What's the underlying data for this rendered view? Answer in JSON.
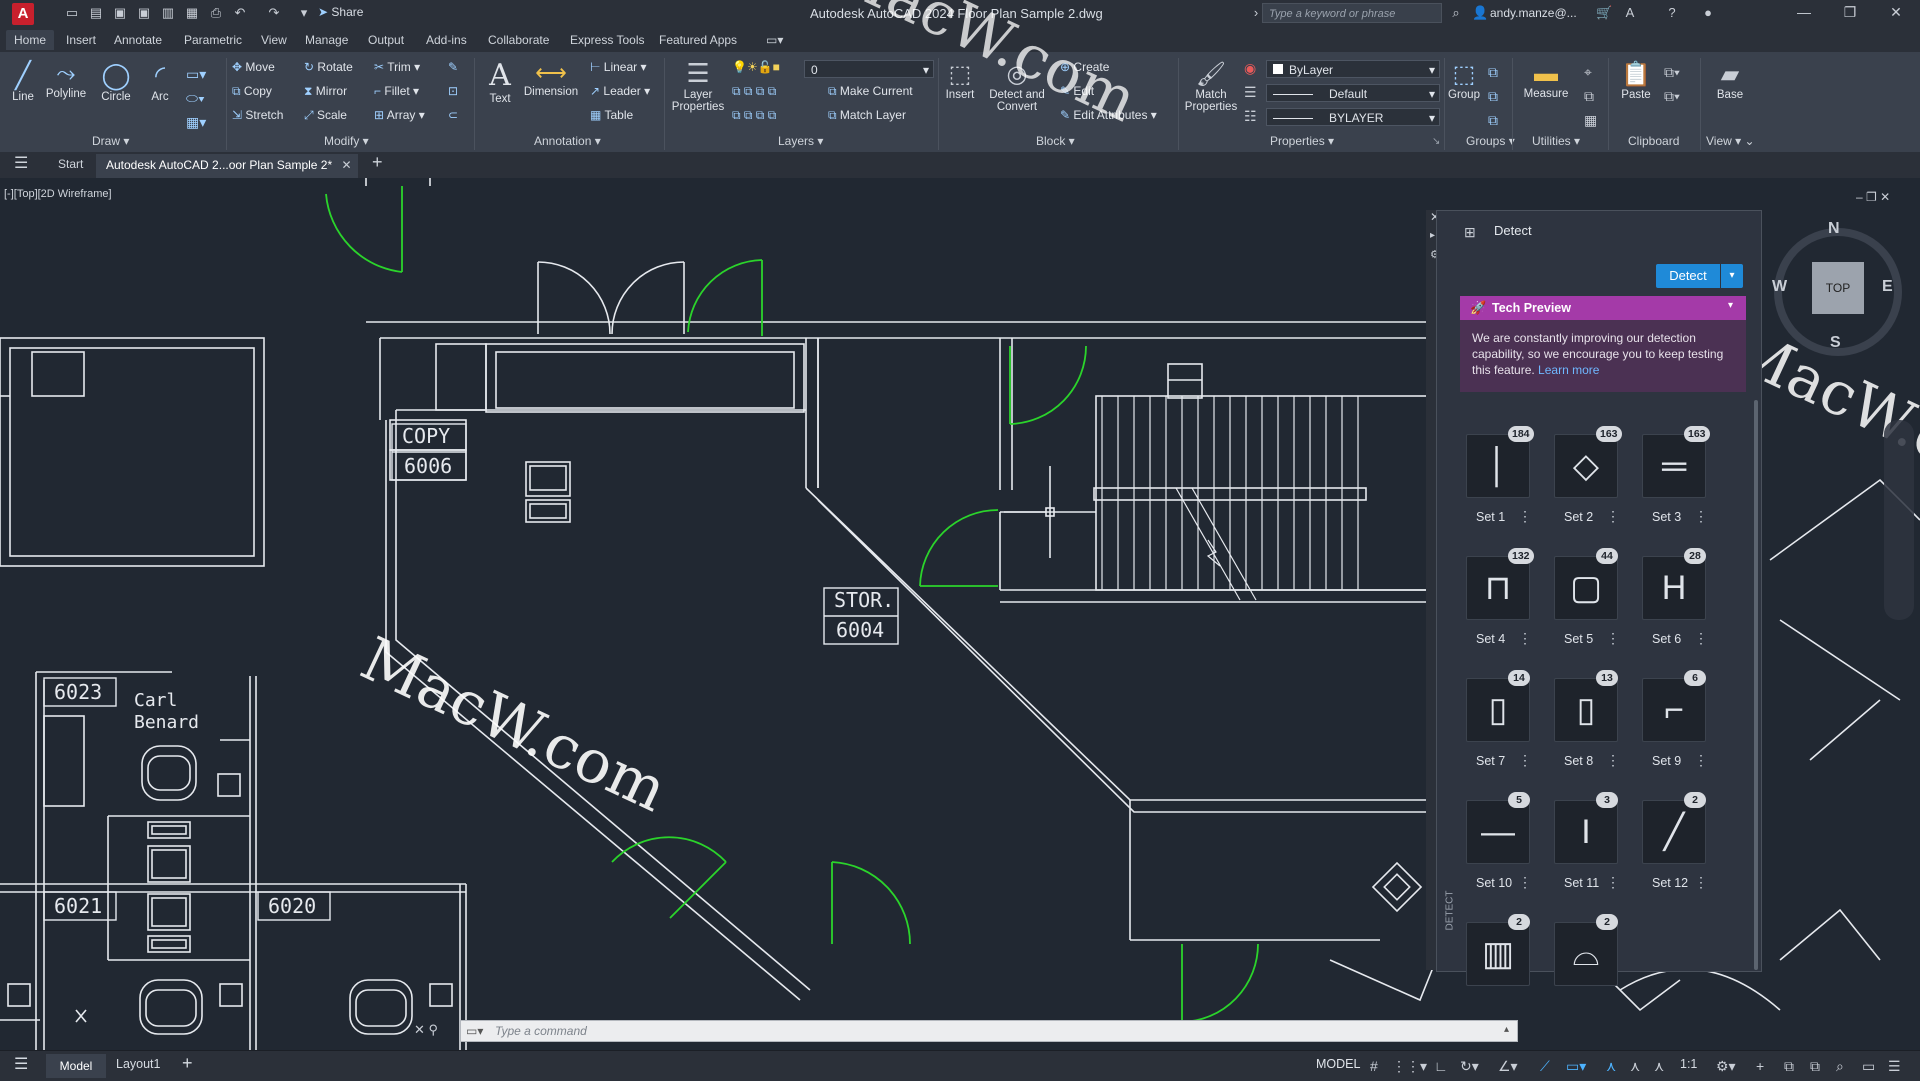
{
  "titlebar": {
    "share": "Share",
    "doc_title": "Autodesk AutoCAD 2024   Floor Plan Sample 2.dwg",
    "search_placeholder": "Type a keyword or phrase",
    "user": "andy.manze@..."
  },
  "menu": [
    "Home",
    "Insert",
    "Annotate",
    "Parametric",
    "View",
    "Manage",
    "Output",
    "Add-ins",
    "Collaborate",
    "Express Tools",
    "Featured Apps"
  ],
  "ribbon": {
    "draw": {
      "title": "Draw",
      "line": "Line",
      "polyline": "Polyline",
      "circle": "Circle",
      "arc": "Arc"
    },
    "modify": {
      "title": "Modify",
      "move": "Move",
      "rotate": "Rotate",
      "trim": "Trim",
      "copy": "Copy",
      "mirror": "Mirror",
      "fillet": "Fillet",
      "stretch": "Stretch",
      "scale": "Scale",
      "array": "Array"
    },
    "annotation": {
      "title": "Annotation",
      "text": "Text",
      "dimension": "Dimension",
      "linear": "Linear",
      "leader": "Leader",
      "table": "Table"
    },
    "layers": {
      "title": "Layers",
      "layer_properties": "Layer Properties",
      "layer_value": "0",
      "make_current": "Make Current",
      "match_layer": "Match Layer"
    },
    "block": {
      "title": "Block",
      "insert": "Insert",
      "detect_convert": "Detect and Convert",
      "create": "Create",
      "edit": "Edit",
      "edit_attributes": "Edit Attributes"
    },
    "properties": {
      "title": "Properties",
      "match": "Match Properties",
      "color": "ByLayer",
      "linetype": "Default",
      "lineweight": "BYLAYER"
    },
    "groups": {
      "title": "Groups",
      "group": "Group"
    },
    "utilities": {
      "title": "Utilities",
      "measure": "Measure"
    },
    "clipboard": {
      "title": "Clipboard",
      "paste": "Paste"
    },
    "view": {
      "title": "View",
      "base": "Base"
    }
  },
  "doctabs": {
    "start": "Start",
    "active": "Autodesk AutoCAD 2...oor Plan Sample 2*"
  },
  "viewport_label": "[-][Top][2D Wireframe]",
  "plan_labels": {
    "copy_name": "COPY",
    "copy_num": "6006",
    "stor_name": "STOR.",
    "stor_num": "6004",
    "r6023": "6023",
    "person1": "Carl",
    "person2": "Benard",
    "r6021": "6021",
    "r6020": "6020"
  },
  "detect_panel": {
    "title": "Detect",
    "button": "Detect",
    "tech_title": "Tech Preview",
    "tech_text": "We are constantly improving our detection capability, so we encourage you to keep testing this feature.",
    "learn_more": "Learn more",
    "vertical_label": "DETECT",
    "sets": [
      {
        "label": "Set 1",
        "count": "184"
      },
      {
        "label": "Set 2",
        "count": "163"
      },
      {
        "label": "Set 3",
        "count": "163"
      },
      {
        "label": "Set 4",
        "count": "132"
      },
      {
        "label": "Set 5",
        "count": "44"
      },
      {
        "label": "Set 6",
        "count": "28"
      },
      {
        "label": "Set 7",
        "count": "14"
      },
      {
        "label": "Set 8",
        "count": "13"
      },
      {
        "label": "Set 9",
        "count": "6"
      },
      {
        "label": "Set 10",
        "count": "5"
      },
      {
        "label": "Set 11",
        "count": "3"
      },
      {
        "label": "Set 12",
        "count": "2"
      },
      {
        "label": "",
        "count": "2"
      },
      {
        "label": "",
        "count": "2"
      }
    ]
  },
  "viewcube": {
    "top": "TOP",
    "n": "N",
    "s": "S",
    "e": "E",
    "w": "W"
  },
  "command": {
    "placeholder": "Type a command"
  },
  "status": {
    "model_tab": "Model",
    "layout_tab": "Layout1",
    "model": "MODEL",
    "scale": "1:1"
  },
  "watermark": "MacW.com",
  "colors": {
    "door": "#2bd42b",
    "walls": "#e6e9ee",
    "accent": "#1f8ad8",
    "tech": "#a43aa8"
  }
}
